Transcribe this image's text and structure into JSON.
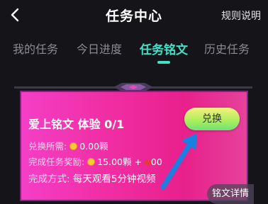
{
  "header": {
    "title": "任务中心",
    "rules_label": "规则说明",
    "back_icon": "chevron-left-icon"
  },
  "tabs": [
    {
      "label": "我的任务",
      "active": false
    },
    {
      "label": "今日进度",
      "active": false
    },
    {
      "label": "任务铭文",
      "active": true
    },
    {
      "label": "历史任务",
      "active": false
    }
  ],
  "card": {
    "title": "爱上铭文  体验 0/1",
    "redeem_label": "兑换",
    "cost_label": "兑换所需:",
    "cost_value": "0.00颗",
    "reward_label": "完成任务奖励:",
    "reward_value": "15.00颗 +",
    "reward_extra": "00",
    "method_label": "完成方式:",
    "method_value": "每天观看5分钟视频",
    "detail_label": "铭文详情"
  },
  "colors": {
    "accent": "#3fe0c8",
    "card": "#f02da2",
    "button": "#a8ee5c",
    "arrow": "#1a7fe0"
  }
}
